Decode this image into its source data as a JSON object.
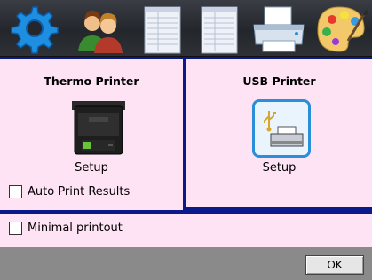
{
  "toolbar": {
    "icons": [
      "gear-icon",
      "users-icon",
      "page-icon",
      "page-icon",
      "printer-icon",
      "palette-icon"
    ]
  },
  "thermo": {
    "title": "Thermo Printer",
    "setup_label": "Setup",
    "auto_print_label": "Auto Print Results"
  },
  "usb": {
    "title": "USB Printer",
    "setup_label": "Setup"
  },
  "minimal": {
    "label": "Minimal printout"
  },
  "footer": {
    "ok_label": "OK"
  },
  "colors": {
    "panel_bg": "#fde3f3",
    "divider": "#0a1a8a",
    "usb_frame": "#2a8fd8",
    "footer_bg": "#8a8a8a"
  }
}
